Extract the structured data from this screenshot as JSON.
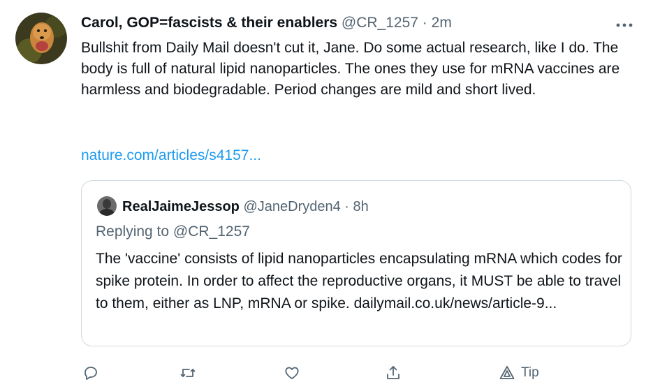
{
  "tweet": {
    "display_name": "Carol, GOP=fascists & their enablers",
    "handle": "@CR_1257",
    "separator": "·",
    "time": "2m",
    "more_icon": "more-horizontal-icon",
    "text": "Bullshit from Daily Mail doesn't cut it, Jane. Do some actual research, like I do. The body is full of natural lipid nanoparticles. The ones they use for mRNA vaccines are harmless and biodegradable. Period changes are mild and short lived.",
    "link": "nature.com/articles/s4157..."
  },
  "quote": {
    "display_name": "RealJaimeJessop",
    "handle": "@JaneDryden4",
    "separator": "·",
    "time": "8h",
    "replying_to_prefix": "Replying to",
    "replying_to_handle": "@CR_1257",
    "text": "The 'vaccine' consists of lipid nanoparticles encapsulating mRNA which codes for spike protein. In order to affect the reproductive organs, it MUST be able to travel to them, either as LNP, mRNA or spike. dailymail.co.uk/news/article-9..."
  },
  "actions": {
    "reply_icon": "reply-icon",
    "retweet_icon": "retweet-icon",
    "like_icon": "like-icon",
    "share_icon": "share-icon",
    "tip_icon": "tip-icon",
    "tip_label": "Tip"
  },
  "colors": {
    "text": "#0f1419",
    "secondary": "#536471",
    "link": "#1d9bf0",
    "border": "#cfd9de"
  }
}
